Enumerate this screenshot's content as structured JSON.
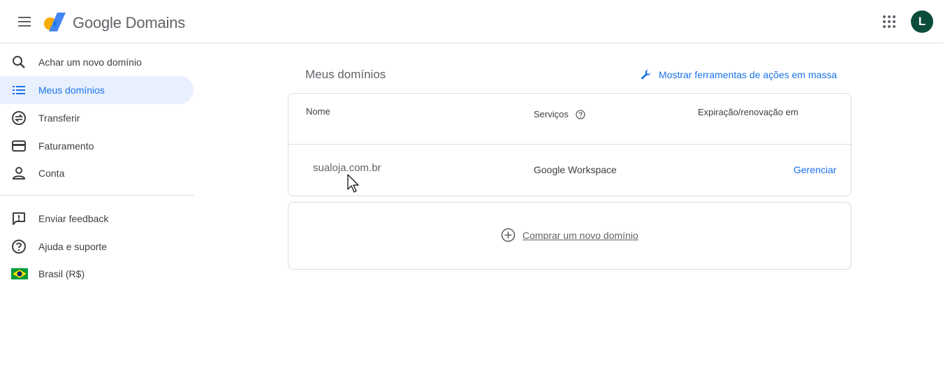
{
  "header": {
    "brand": "Google Domains",
    "avatar_letter": "L",
    "menu_icon": "menu-icon",
    "apps_icon": "apps-grid-icon"
  },
  "sidebar": {
    "items": [
      {
        "label": "Achar um novo domínio",
        "icon": "search-icon",
        "active": false
      },
      {
        "label": "Meus domínios",
        "icon": "list-icon",
        "active": true
      },
      {
        "label": "Transferir",
        "icon": "transfer-icon",
        "active": false
      },
      {
        "label": "Faturamento",
        "icon": "credit-card-icon",
        "active": false
      },
      {
        "label": "Conta",
        "icon": "person-icon",
        "active": false
      }
    ],
    "footer_items": [
      {
        "label": "Enviar feedback",
        "icon": "feedback-icon"
      },
      {
        "label": "Ajuda e suporte",
        "icon": "help-icon"
      },
      {
        "label": "Brasil (R$)",
        "icon": "brazil-flag-icon"
      }
    ]
  },
  "main": {
    "title": "Meus domínios",
    "bulk_tools_label": "Mostrar ferramentas de ações em massa",
    "table": {
      "headers": {
        "name": "Nome",
        "services": "Serviços",
        "expiration": "Expiração/renovação em"
      },
      "rows": [
        {
          "domain": "sualoja.com.br",
          "service": "Google Workspace",
          "action": "Gerenciar"
        }
      ]
    },
    "buy_label": "Comprar um novo domínio"
  },
  "colors": {
    "accent": "#1a73e8",
    "active_bg": "#e8f0fe",
    "avatar_bg": "#0b4c3a"
  }
}
